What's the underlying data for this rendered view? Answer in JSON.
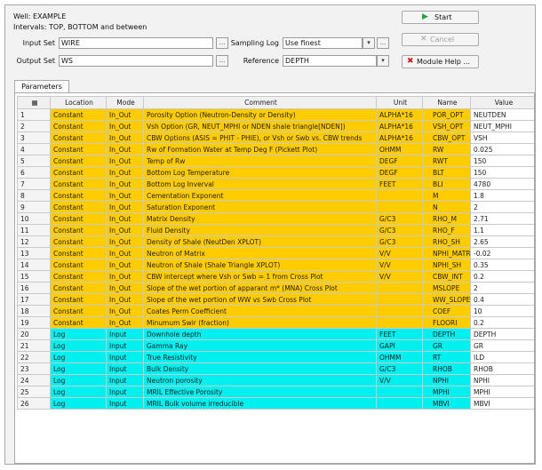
{
  "header": {
    "well_line": "Well: EXAMPLE",
    "intervals_line": "Intervals: TOP, BOTTOM and between"
  },
  "form": {
    "input_set_label": "Input Set",
    "input_set_value": "WIRE",
    "output_set_label": "Output Set",
    "output_set_value": "WS",
    "sampling_log_label": "Sampling Log",
    "sampling_log_value": "Use finest",
    "reference_label": "Reference",
    "reference_value": "DEPTH",
    "browse_label": "...",
    "dropdown_glyph": "▾"
  },
  "buttons": {
    "start": "Start",
    "cancel": "Cancel",
    "module_help": "Module Help ..."
  },
  "tabs": [
    "Parameters"
  ],
  "table": {
    "columns": [
      "Location",
      "Mode",
      "Comment",
      "Unit",
      "Name",
      "Value"
    ],
    "rows": [
      {
        "num": "1",
        "location": "Constant",
        "mode": "In_Out",
        "comment": "Porosity Option (Neutron-Density or Density)",
        "unit": "ALPHA*16",
        "name": "POR_OPT",
        "value": "NEUTDEN",
        "color": "yellow"
      },
      {
        "num": "2",
        "location": "Constant",
        "mode": "In_Out",
        "comment": "Vsh Option (GR, NEUT_MPHI or NDEN shale triangle[NDEN])",
        "unit": "ALPHA*16",
        "name": "VSH_OPT",
        "value": "NEUT_MPHI",
        "color": "yellow"
      },
      {
        "num": "3",
        "location": "Constant",
        "mode": "In_Out",
        "comment": "CBW Options (ASIS = PHIT - PHIE), or Vsh or Swb vs. CBW trends",
        "unit": "ALPHA*16",
        "name": "CBW_OPT",
        "value": "VSH",
        "color": "yellow"
      },
      {
        "num": "4",
        "location": "Constant",
        "mode": "In_Out",
        "comment": "Rw of Formation Water at Temp Deg F (Pickett Plot)",
        "unit": "OHMM",
        "name": "RW",
        "value": "0.025",
        "color": "yellow"
      },
      {
        "num": "5",
        "location": "Constant",
        "mode": "In_Out",
        "comment": "Temp of Rw",
        "unit": "DEGF",
        "name": "RWT",
        "value": "150",
        "color": "yellow"
      },
      {
        "num": "6",
        "location": "Constant",
        "mode": "In_Out",
        "comment": "Bottom Log Temperature",
        "unit": "DEGF",
        "name": "BLT",
        "value": "150",
        "color": "yellow"
      },
      {
        "num": "7",
        "location": "Constant",
        "mode": "In_Out",
        "comment": "Bottom Log Inverval",
        "unit": "FEET",
        "name": "BLI",
        "value": "4780",
        "color": "yellow"
      },
      {
        "num": "8",
        "location": "Constant",
        "mode": "In_Out",
        "comment": "Cementation Exponent",
        "unit": "",
        "name": "M",
        "value": "1.8",
        "color": "yellow"
      },
      {
        "num": "9",
        "location": "Constant",
        "mode": "In_Out",
        "comment": "Saturation Exponent",
        "unit": "",
        "name": "N",
        "value": "2",
        "color": "yellow"
      },
      {
        "num": "10",
        "location": "Constant",
        "mode": "In_Out",
        "comment": "Matrix Density",
        "unit": "G/C3",
        "name": "RHO_M",
        "value": "2.71",
        "color": "yellow"
      },
      {
        "num": "11",
        "location": "Constant",
        "mode": "In_Out",
        "comment": "Fluid Density",
        "unit": "G/C3",
        "name": "RHO_F",
        "value": "1.1",
        "color": "yellow"
      },
      {
        "num": "12",
        "location": "Constant",
        "mode": "In_Out",
        "comment": "Density of Shale (NeutDen XPLOT)",
        "unit": "G/C3",
        "name": "RHO_SH",
        "value": "2.65",
        "color": "yellow"
      },
      {
        "num": "13",
        "location": "Constant",
        "mode": "In_Out",
        "comment": "Neutron of Matrix",
        "unit": "V/V",
        "name": "NPHI_MATRIX",
        "value": "-0.02",
        "color": "yellow"
      },
      {
        "num": "14",
        "location": "Constant",
        "mode": "In_Out",
        "comment": "Neutron of Shale (Shale Triangle XPLOT)",
        "unit": "V/V",
        "name": "NPHI_SH",
        "value": "0.35",
        "color": "yellow"
      },
      {
        "num": "15",
        "location": "Constant",
        "mode": "In_Out",
        "comment": "CBW intercept where Vsh or Swb = 1 from Cross Plot",
        "unit": "V/V",
        "name": "CBW_INT",
        "value": "0.2",
        "color": "yellow"
      },
      {
        "num": "16",
        "location": "Constant",
        "mode": "In_Out",
        "comment": "Slope of the wet portion of apparant m* (MNA) Cross Plot",
        "unit": "",
        "name": "MSLOPE",
        "value": "2",
        "color": "yellow"
      },
      {
        "num": "17",
        "location": "Constant",
        "mode": "In_Out",
        "comment": "Slope of the wet portion of WW vs Swb Cross Plot",
        "unit": "",
        "name": "WW_SLOPE",
        "value": "0.4",
        "color": "yellow"
      },
      {
        "num": "18",
        "location": "Constant",
        "mode": "In_Out",
        "comment": "Coates Perm Coefficient",
        "unit": "",
        "name": "COEF",
        "value": "10",
        "color": "yellow"
      },
      {
        "num": "19",
        "location": "Constant",
        "mode": "In_Out",
        "comment": "Minumum Swir (fraction)",
        "unit": "",
        "name": "FLOORI",
        "value": "0.2",
        "color": "yellow"
      },
      {
        "num": "20",
        "location": "Log",
        "mode": "Input",
        "comment": "Downhole depth",
        "unit": "FEET",
        "name": "DEPTH",
        "value": "DEPTH",
        "color": "cyan"
      },
      {
        "num": "21",
        "location": "Log",
        "mode": "Input",
        "comment": "Gamma Ray",
        "unit": "GAPI",
        "name": "GR",
        "value": "GR",
        "color": "cyan"
      },
      {
        "num": "22",
        "location": "Log",
        "mode": "Input",
        "comment": "True Resistivity",
        "unit": "OHMM",
        "name": "RT",
        "value": "ILD",
        "color": "cyan"
      },
      {
        "num": "23",
        "location": "Log",
        "mode": "Input",
        "comment": "Bulk Density",
        "unit": "G/C3",
        "name": "RHOB",
        "value": "RHOB",
        "color": "cyan"
      },
      {
        "num": "24",
        "location": "Log",
        "mode": "Input",
        "comment": "Neutron porosity",
        "unit": "V/V",
        "name": "NPHI",
        "value": "NPHI",
        "color": "cyan"
      },
      {
        "num": "25",
        "location": "Log",
        "mode": "Input",
        "comment": "MRIL Effective Porosity",
        "unit": "",
        "name": "MPHI",
        "value": "MPHI",
        "color": "cyan"
      },
      {
        "num": "26",
        "location": "Log",
        "mode": "Input",
        "comment": "MRIL Bulk volume irreducible",
        "unit": "",
        "name": "MBVI",
        "value": "MBVI",
        "color": "cyan"
      }
    ]
  },
  "colors": {
    "constant_row": "#ffcc00",
    "log_row": "#00f0f0",
    "start_icon": "#22a33a",
    "module_help_icon": "#d0201e"
  }
}
